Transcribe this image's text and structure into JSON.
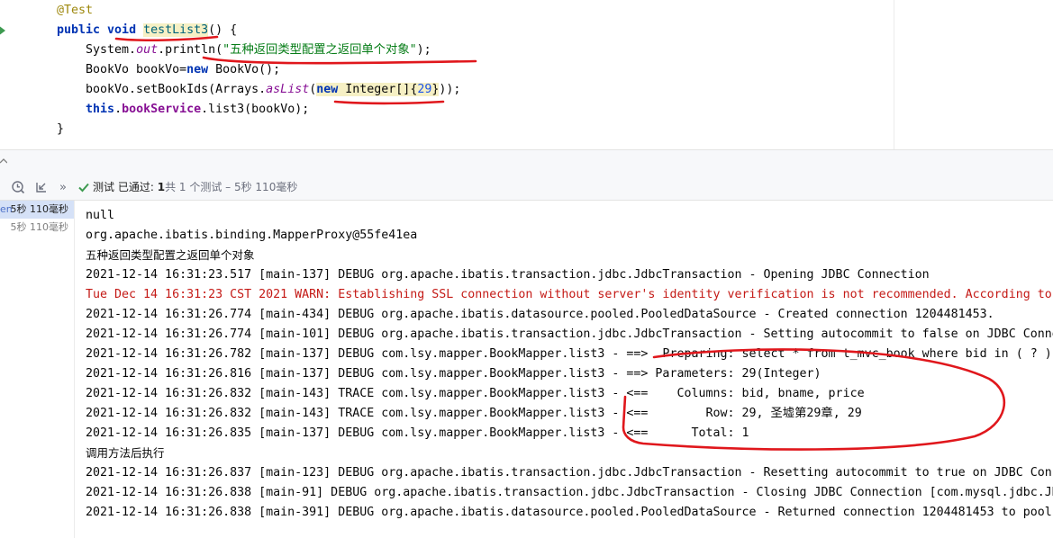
{
  "editor": {
    "lines": [
      {
        "segments": [
          {
            "t": "@Test",
            "c": "ann"
          }
        ]
      },
      {
        "segments": [
          {
            "t": "public ",
            "c": "kw"
          },
          {
            "t": "void ",
            "c": "kw"
          },
          {
            "t": "testList3",
            "c": "fn"
          },
          {
            "t": "() {",
            "c": ""
          }
        ]
      },
      {
        "segments": [
          {
            "t": "    System.",
            "c": ""
          },
          {
            "t": "out",
            "c": "st"
          },
          {
            "t": ".println(",
            "c": ""
          },
          {
            "t": "\"五种返回类型配置之返回单个对象\"",
            "c": "str"
          },
          {
            "t": ");",
            "c": ""
          }
        ]
      },
      {
        "segments": [
          {
            "t": "    BookVo bookVo=",
            "c": ""
          },
          {
            "t": "new ",
            "c": "kw"
          },
          {
            "t": "BookVo();",
            "c": ""
          }
        ]
      },
      {
        "segments": [
          {
            "t": "    bookVo.setBookIds(Arrays.",
            "c": ""
          },
          {
            "t": "asList",
            "c": "st"
          },
          {
            "t": "(",
            "c": ""
          },
          {
            "t": "new ",
            "c": "kw hl"
          },
          {
            "t": "Integer[]{",
            "c": "hl"
          },
          {
            "t": "29",
            "c": "num hl"
          },
          {
            "t": "}",
            "c": "hl"
          },
          {
            "t": "));",
            "c": ""
          }
        ]
      },
      {
        "segments": [
          {
            "t": "    ",
            "c": ""
          },
          {
            "t": "this",
            "c": "kw"
          },
          {
            "t": ".",
            "c": ""
          },
          {
            "t": "bookService",
            "c": "fld"
          },
          {
            "t": ".list3(bookVo);",
            "c": ""
          }
        ]
      },
      {
        "segments": [
          {
            "t": "}",
            "c": ""
          }
        ]
      }
    ]
  },
  "toolbar": {
    "status_prefix": "测试",
    "status_passed": "已通过:",
    "status_count": "1",
    "status_rest": "共 1 个测试 – 5秒 110毫秒"
  },
  "tree": {
    "rows": [
      {
        "prefix": "en",
        "time": "5秒 110毫秒",
        "selected": true
      },
      {
        "prefix": "",
        "time": "5秒 110毫秒",
        "selected": false
      }
    ]
  },
  "console": {
    "lines": [
      {
        "text": "null",
        "kind": ""
      },
      {
        "text": "org.apache.ibatis.binding.MapperProxy@55fe41ea",
        "kind": ""
      },
      {
        "text": "五种返回类型配置之返回单个对象",
        "kind": "cn"
      },
      {
        "text": "2021-12-14 16:31:23.517 [main-137] DEBUG org.apache.ibatis.transaction.jdbc.JdbcTransaction - Opening JDBC Connection",
        "kind": ""
      },
      {
        "text": "Tue Dec 14 16:31:23 CST 2021 WARN: Establishing SSL connection without server's identity verification is not recommended. According to",
        "kind": "warn"
      },
      {
        "text": "2021-12-14 16:31:26.774 [main-434] DEBUG org.apache.ibatis.datasource.pooled.PooledDataSource - Created connection 1204481453.",
        "kind": ""
      },
      {
        "text": "2021-12-14 16:31:26.774 [main-101] DEBUG org.apache.ibatis.transaction.jdbc.JdbcTransaction - Setting autocommit to false on JDBC Conne",
        "kind": ""
      },
      {
        "text": "2021-12-14 16:31:26.782 [main-137] DEBUG com.lsy.mapper.BookMapper.list3 - ==>  Preparing: select * from t_mvc_book where bid in ( ? )",
        "kind": ""
      },
      {
        "text": "2021-12-14 16:31:26.816 [main-137] DEBUG com.lsy.mapper.BookMapper.list3 - ==> Parameters: 29(Integer)",
        "kind": ""
      },
      {
        "text": "2021-12-14 16:31:26.832 [main-143] TRACE com.lsy.mapper.BookMapper.list3 - <==    Columns: bid, bname, price",
        "kind": ""
      },
      {
        "text": "2021-12-14 16:31:26.832 [main-143] TRACE com.lsy.mapper.BookMapper.list3 - <==        Row: 29, 圣墟第29章, 29",
        "kind": ""
      },
      {
        "text": "2021-12-14 16:31:26.835 [main-137] DEBUG com.lsy.mapper.BookMapper.list3 - <==      Total: 1",
        "kind": ""
      },
      {
        "text": "调用方法后执行",
        "kind": "cn"
      },
      {
        "text": "2021-12-14 16:31:26.837 [main-123] DEBUG org.apache.ibatis.transaction.jdbc.JdbcTransaction - Resetting autocommit to true on JDBC Conn",
        "kind": ""
      },
      {
        "text": "2021-12-14 16:31:26.838 [main-91] DEBUG org.apache.ibatis.transaction.jdbc.JdbcTransaction - Closing JDBC Connection [com.mysql.jdbc.JD",
        "kind": ""
      },
      {
        "text": "2021-12-14 16:31:26.838 [main-391] DEBUG org.apache.ibatis.datasource.pooled.PooledDataSource - Returned connection 1204481453 to pool",
        "kind": ""
      }
    ]
  },
  "colors": {
    "annotation_red": "#e0171c",
    "pass_green": "#3d9a50",
    "accent_blue": "#4f72c9"
  }
}
